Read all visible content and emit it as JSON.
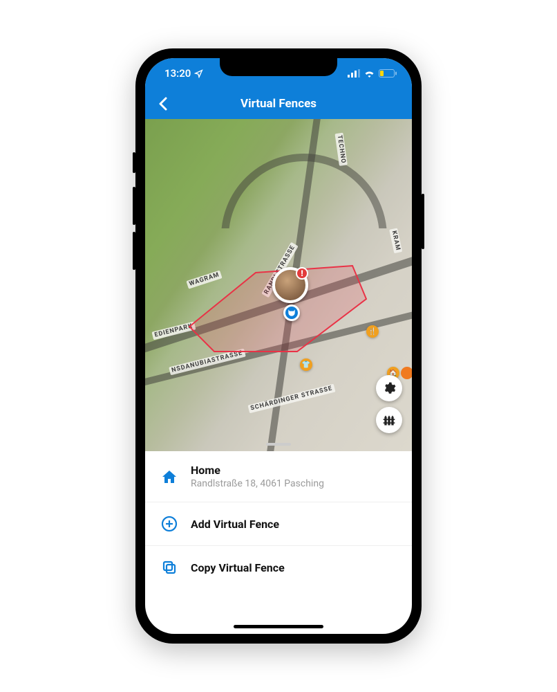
{
  "status_bar": {
    "time": "13:20"
  },
  "header": {
    "title": "Virtual Fences"
  },
  "map": {
    "streets": {
      "wagram": "WAGRAM",
      "randl": "RANDLSTRASSE",
      "danubia": "NSDANUBIASTRASSE",
      "schard": "SCHÄRDINGER STRASSE",
      "techno": "TECHNO",
      "kram": "KRAM",
      "medien": "EDIENPARK"
    },
    "alert_badge": "!"
  },
  "sheet": {
    "home": {
      "title": "Home",
      "subtitle": "Randlstraße 18, 4061 Pasching"
    },
    "add": {
      "title": "Add Virtual Fence"
    },
    "copy": {
      "title": "Copy Virtual Fence"
    }
  }
}
